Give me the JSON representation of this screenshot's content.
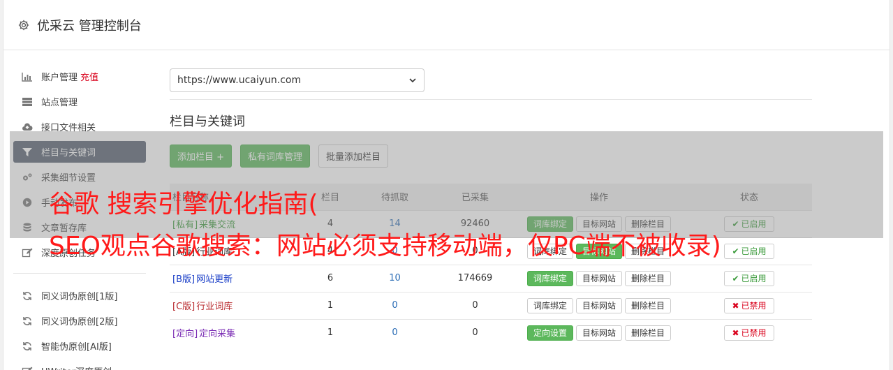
{
  "app": {
    "title": "优采云 管理控制台"
  },
  "sidebar": {
    "items": [
      {
        "label": "账户管理",
        "extra": "充值",
        "icon": "bar-chart-icon"
      },
      {
        "label": "站点管理",
        "icon": "server-icon"
      },
      {
        "label": "接口文件相关",
        "icon": "cloud-upload-icon"
      },
      {
        "label": "栏目与关键词",
        "icon": "filter-icon",
        "active": true
      },
      {
        "label": "采集细节设置",
        "icon": "gears-icon"
      },
      {
        "label": "手动发布",
        "icon": "play-circle-icon"
      },
      {
        "label": "文章暂存库",
        "icon": "database-icon"
      },
      {
        "label": "深度原创任务",
        "icon": "edit-icon"
      }
    ],
    "items2": [
      {
        "label": "同义词伪原创[1版]",
        "icon": "refresh-icon"
      },
      {
        "label": "同义词伪原创[2版]",
        "icon": "refresh-icon"
      },
      {
        "label": "智能伪原创[AI版]",
        "icon": "refresh-icon"
      },
      {
        "label": "UWriter深度原创",
        "icon": "edit-icon"
      }
    ]
  },
  "site_select": {
    "value": "https://www.ucaiyun.com"
  },
  "section": {
    "title": "栏目与关键词"
  },
  "toolbar": {
    "add_column": "添加栏目 +",
    "private_lexicon": "私有词库管理",
    "batch_add": "批量添加栏目"
  },
  "table": {
    "headers": [
      "栏目名称",
      "栏目",
      "待抓取",
      "已采集",
      "操作",
      "状态"
    ],
    "rows": [
      {
        "tag": "[私有]",
        "name": "采集交流",
        "cls": "c-private",
        "count": "4",
        "pending": "14",
        "collected": "92460",
        "op1": "词库绑定",
        "op1_green": true,
        "op2": "目标网站",
        "op2_green": false,
        "op3": "删除栏目",
        "status": "已启用",
        "on": true
      },
      {
        "tag": "[A版]",
        "name": "行业词库",
        "cls": "c-a",
        "count": "4",
        "pending": "0",
        "collected": "0",
        "op1": "词库绑定",
        "op1_green": false,
        "op2": "目标网站",
        "op2_green": true,
        "op3": "删除栏目",
        "status": "已启用",
        "on": true
      },
      {
        "tag": "[B版]",
        "name": "网站更新",
        "cls": "c-b",
        "count": "6",
        "pending": "10",
        "collected": "174669",
        "op1": "词库绑定",
        "op1_green": true,
        "op2": "目标网站",
        "op2_green": false,
        "op3": "删除栏目",
        "status": "已启用",
        "on": true
      },
      {
        "tag": "[C版]",
        "name": "行业词库",
        "cls": "c-c",
        "count": "1",
        "pending": "0",
        "collected": "0",
        "op1": "词库绑定",
        "op1_green": false,
        "op2": "目标网站",
        "op2_green": false,
        "op3": "删除栏目",
        "status": "已禁用",
        "on": false
      },
      {
        "tag": "[定向]",
        "name": "定向采集",
        "cls": "c-dir",
        "count": "1",
        "pending": "0",
        "collected": "0",
        "op1": "定向设置",
        "op1_green": true,
        "op2": "目标网站",
        "op2_green": false,
        "op3": "删除栏目",
        "status": "已禁用",
        "on": false
      }
    ]
  },
  "watermark": {
    "line1": "谷歌 搜索引擎优化指南(",
    "line2": "SEO观点谷歌搜索：网站必须支持移动端，仅PC端不被收录)"
  },
  "colors": {
    "accent_green": "#5cb85c",
    "active_nav": "#56606f",
    "recharge": "#d9001b"
  }
}
